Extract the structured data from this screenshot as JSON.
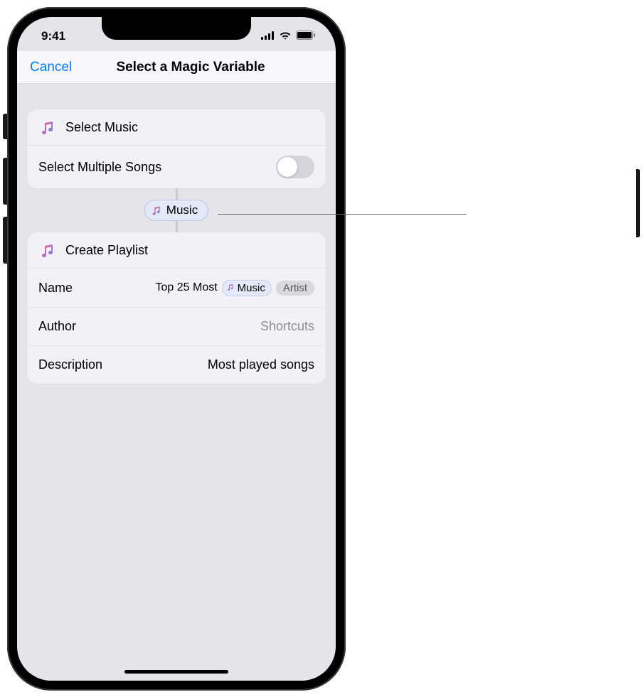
{
  "statusBar": {
    "time": "9:41"
  },
  "nav": {
    "cancel": "Cancel",
    "title": "Select a Magic Variable"
  },
  "card1": {
    "title": "Select Music",
    "toggleLabel": "Select Multiple Songs"
  },
  "magicVariable": {
    "label": "Music"
  },
  "card2": {
    "title": "Create Playlist",
    "rows": {
      "name": {
        "label": "Name",
        "value": "Top 25 Most",
        "pill": "Music",
        "tag": "Artist"
      },
      "author": {
        "label": "Author",
        "value": "Shortcuts"
      },
      "description": {
        "label": "Description",
        "value": "Most played songs"
      }
    }
  }
}
